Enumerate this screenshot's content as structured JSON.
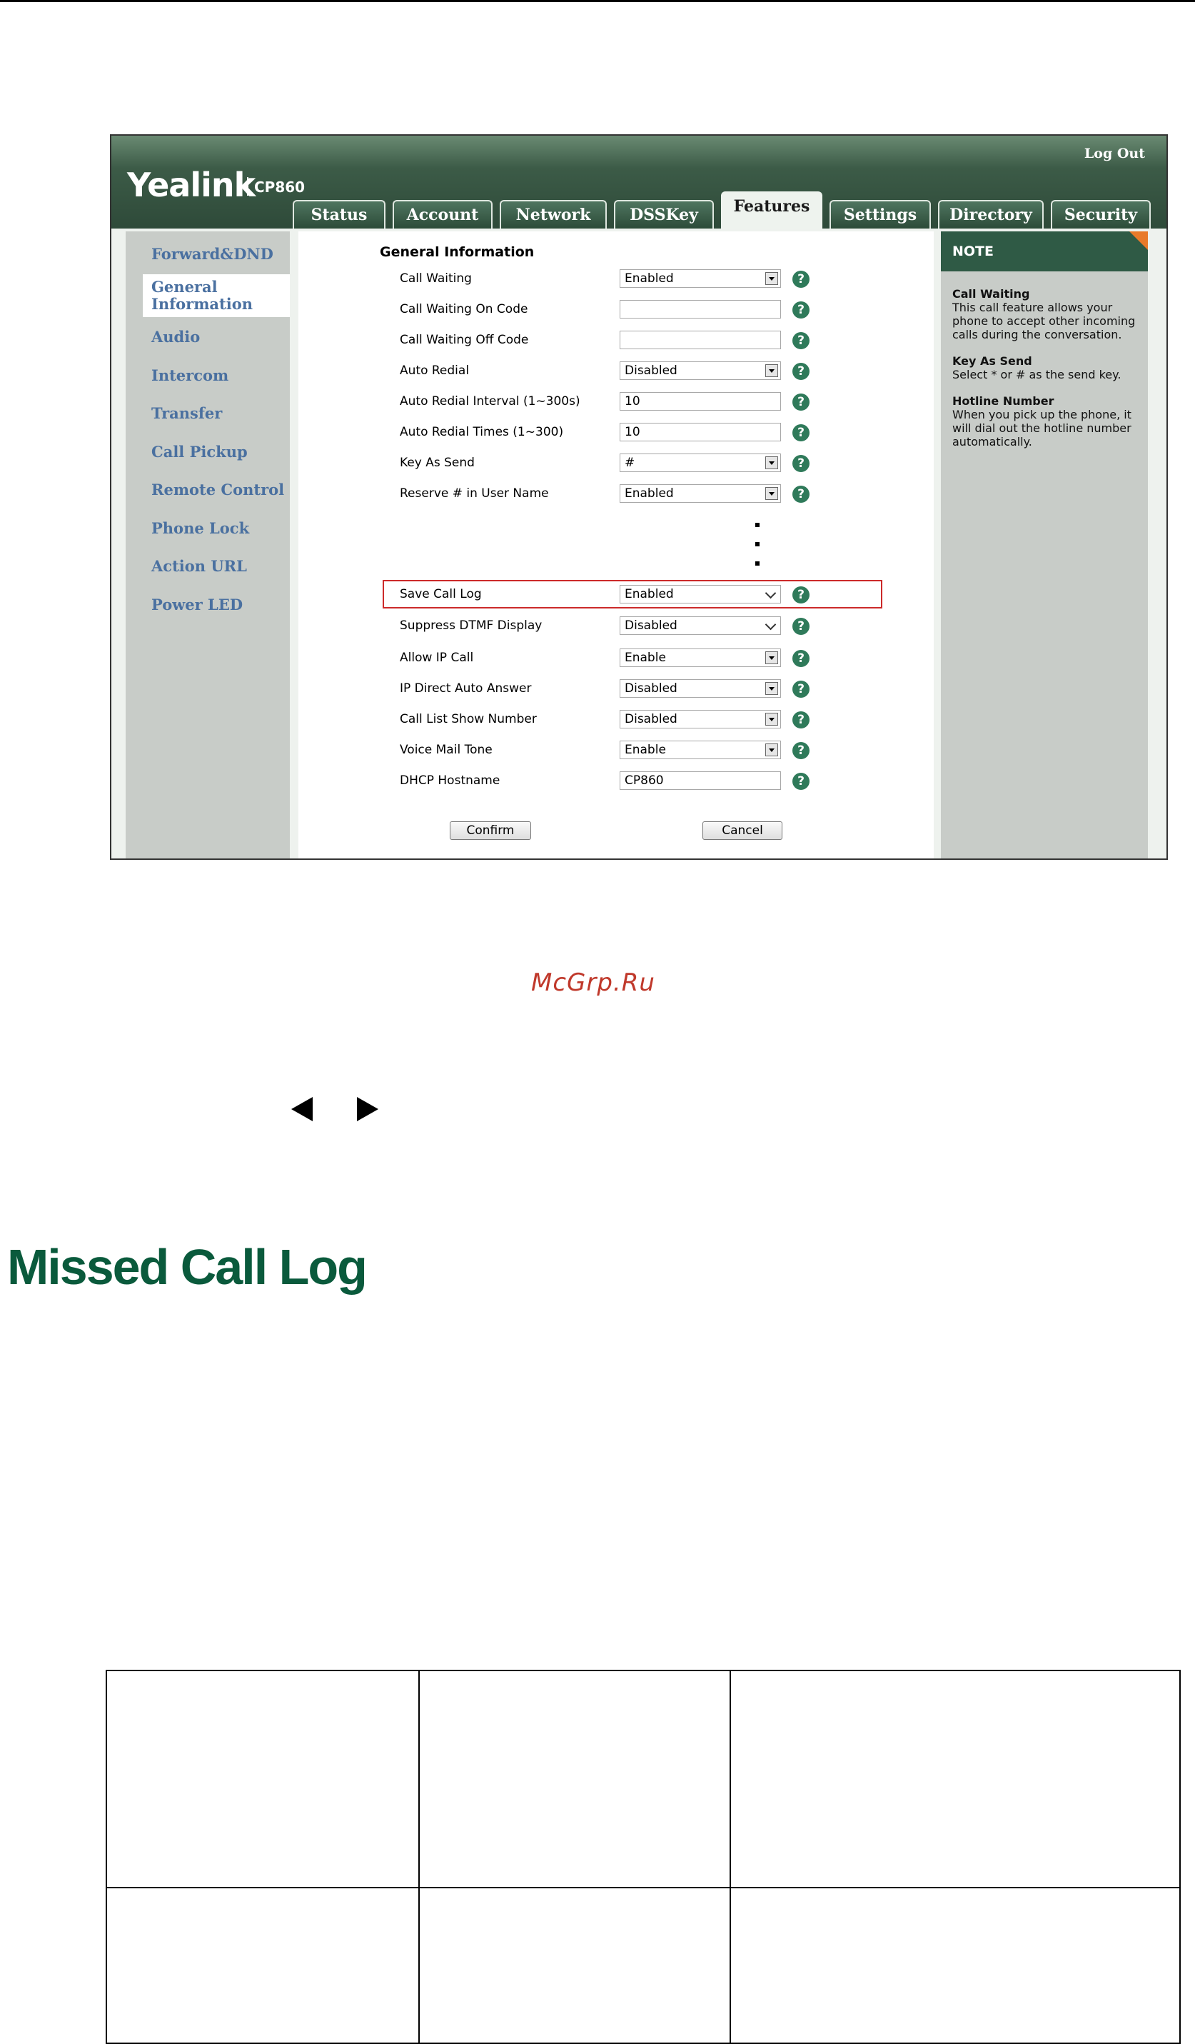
{
  "ui": {
    "logo": "Yealink",
    "model": "CP860",
    "logout": "Log Out",
    "tabs": [
      "Status",
      "Account",
      "Network",
      "DSSKey",
      "Features",
      "Settings",
      "Directory",
      "Security"
    ],
    "active_tab": "Features",
    "sidebar": [
      "Forward&DND",
      "General Information",
      "Audio",
      "Intercom",
      "Transfer",
      "Call Pickup",
      "Remote Control",
      "Phone Lock",
      "Action URL",
      "Power LED"
    ],
    "active_sidebar": "General Information",
    "section_title": "General Information",
    "rows": [
      {
        "label": "Call Waiting",
        "value": "Enabled",
        "type": "select"
      },
      {
        "label": "Call Waiting On Code",
        "value": "",
        "type": "text"
      },
      {
        "label": "Call Waiting Off Code",
        "value": "",
        "type": "text"
      },
      {
        "label": "Auto Redial",
        "value": "Disabled",
        "type": "select"
      },
      {
        "label": "Auto Redial Interval (1~300s)",
        "value": "10",
        "type": "text"
      },
      {
        "label": "Auto Redial Times (1~300)",
        "value": "10",
        "type": "text"
      },
      {
        "label": "Key As Send",
        "value": "#",
        "type": "select"
      },
      {
        "label": "Reserve # in User Name",
        "value": "Enabled",
        "type": "select"
      },
      {
        "label": "Save Call Log",
        "value": "Enabled",
        "type": "select-chevron"
      },
      {
        "label": "Suppress DTMF Display",
        "value": "Disabled",
        "type": "select-chevron"
      },
      {
        "label": "Allow IP Call",
        "value": "Enable",
        "type": "select"
      },
      {
        "label": "IP Direct Auto Answer",
        "value": "Disabled",
        "type": "select"
      },
      {
        "label": "Call List Show Number",
        "value": "Disabled",
        "type": "select"
      },
      {
        "label": "Voice Mail Tone",
        "value": "Enable",
        "type": "select"
      },
      {
        "label": "DHCP Hostname",
        "value": "CP860",
        "type": "text"
      }
    ],
    "help_glyph": "?",
    "confirm": "Confirm",
    "cancel": "Cancel",
    "note": {
      "title": "NOTE",
      "items": [
        {
          "title": "Call Waiting",
          "text": "This call feature allows your phone to accept other incoming calls during the conversation."
        },
        {
          "title": "Key As Send",
          "text": "Select * or # as the send key."
        },
        {
          "title": "Hotline Number",
          "text": "When you pick up the phone, it will dial out the hotline number automatically."
        }
      ]
    },
    "colors": {
      "header": "#3c5b47",
      "note_header": "#2f5a45",
      "highlight": "#cc2a2a",
      "sidebar_link": "#4a70a0",
      "help_icon": "#2f7a5a"
    }
  },
  "doc": {
    "watermark": "McGrp.Ru",
    "heading": "Missed Call Log",
    "heading_color": "#0a5a3c"
  }
}
